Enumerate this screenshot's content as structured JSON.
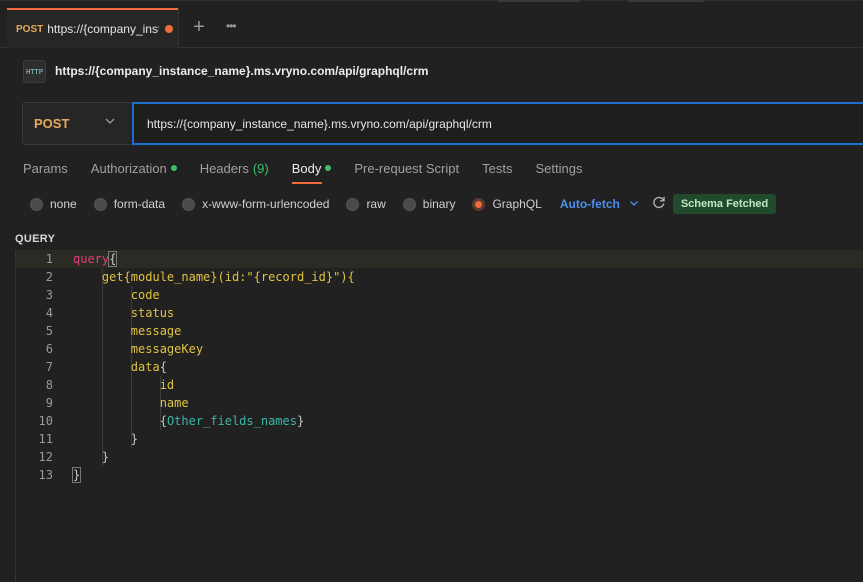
{
  "tabbar": {
    "tab": {
      "method": "POST",
      "url": "https://{company_inst"
    },
    "new_tab": "+",
    "more": "•••"
  },
  "request": {
    "icon_text": "HTTP",
    "title": "https://{company_instance_name}.ms.vryno.com/api/graphql/crm",
    "method": "POST",
    "url": "https://{company_instance_name}.ms.vryno.com/api/graphql/crm"
  },
  "request_tabs": [
    {
      "label": "Params"
    },
    {
      "label": "Authorization",
      "dot": true
    },
    {
      "label": "Headers",
      "count": "(9)"
    },
    {
      "label": "Body",
      "dot": true,
      "active": true
    },
    {
      "label": "Pre-request Script"
    },
    {
      "label": "Tests"
    },
    {
      "label": "Settings"
    }
  ],
  "body_types": {
    "options": [
      "none",
      "form-data",
      "x-www-form-urlencoded",
      "raw",
      "binary",
      "GraphQL"
    ],
    "selected": "GraphQL",
    "autofetch": "Auto-fetch",
    "schema_status": "Schema Fetched"
  },
  "query": {
    "label": "QUERY",
    "line_numbers": [
      "1",
      "2",
      "3",
      "4",
      "5",
      "6",
      "7",
      "8",
      "9",
      "10",
      "11",
      "12",
      "13"
    ],
    "lines": {
      "l1_kw": "query",
      "l1_brace": "{",
      "l2_fn": "get{module_name}",
      "l2_args": "(id:\"{record_id}\"){",
      "l3": "code",
      "l4": "status",
      "l5": "message",
      "l6": "messageKey",
      "l7_fld": "data",
      "l7_brace": "{",
      "l8": "id",
      "l9": "name",
      "l10_open": "{",
      "l10_var": "Other_fields_names",
      "l10_close": "}",
      "l11": "}",
      "l12": "}",
      "l13": "}"
    }
  },
  "colors": {
    "accent": "#f26b3a",
    "method": "#e8a95b",
    "focus_border": "#1f6fd1",
    "success": "#3fbf6a",
    "link": "#4a8ef0"
  }
}
